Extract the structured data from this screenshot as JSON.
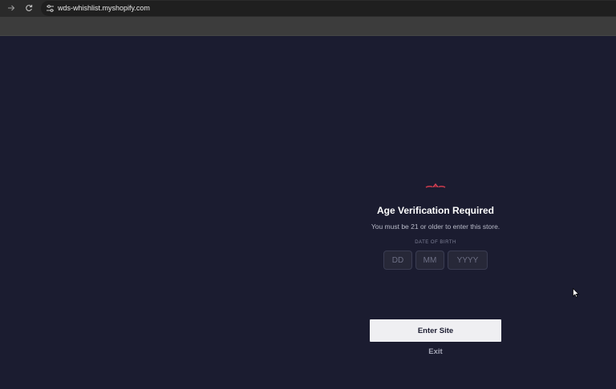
{
  "browser": {
    "url": "wds-whishlist.myshopify.com",
    "forward_icon": "arrow-right-icon",
    "reload_icon": "reload-icon",
    "site_info_icon": "tune-icon"
  },
  "age_gate": {
    "logo_icon": "brand-logo-icon",
    "title": "Age Verification Required",
    "subtitle": "You must be 21 or older to enter this store.",
    "dob_label": "DATE OF BIRTH",
    "day_placeholder": "DD",
    "month_placeholder": "MM",
    "year_placeholder": "YYYY",
    "enter_label": "Enter Site",
    "exit_label": "Exit"
  },
  "colors": {
    "page_background": "#1b1c30",
    "button_background": "#efeff2",
    "accent": "#c0394b"
  }
}
